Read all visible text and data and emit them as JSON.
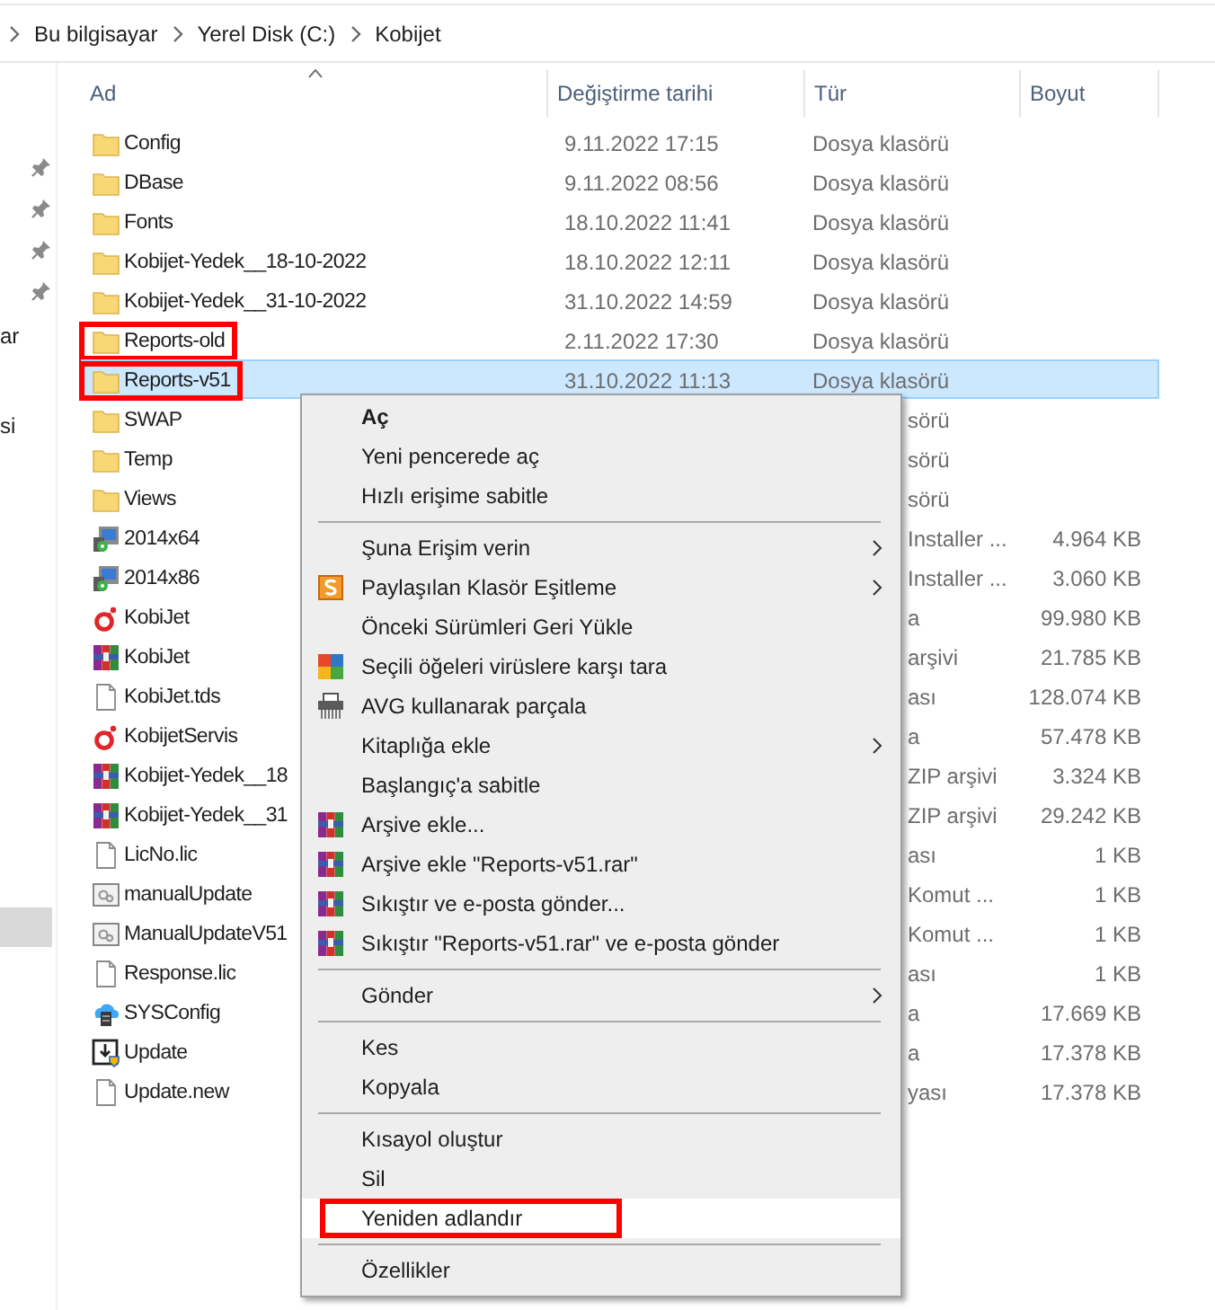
{
  "breadcrumb": [
    "Bu bilgisayar",
    "Yerel Disk (C:)",
    "Kobijet"
  ],
  "nav": {
    "items": [
      {
        "kind": "pin",
        "selected": false
      },
      {
        "kind": "pin",
        "selected": false
      },
      {
        "kind": "pin",
        "selected": false
      },
      {
        "kind": "pin",
        "selected": false
      },
      {
        "kind": "label",
        "text": "ar",
        "selected": false
      },
      {
        "kind": "label",
        "text": "si",
        "selected": false
      },
      {
        "kind": "row",
        "selected": true
      }
    ]
  },
  "table": {
    "columns": [
      {
        "label": "Ad",
        "sorted": true
      },
      {
        "label": "Değiştirme tarihi",
        "sorted": false
      },
      {
        "label": "Tür",
        "sorted": false
      },
      {
        "label": "Boyut",
        "sorted": false
      }
    ],
    "rows": [
      {
        "kind": "folder",
        "name": "Config",
        "date": "9.11.2022 17:15",
        "type": "Dosya klasörü",
        "selected": false,
        "highlighted": false
      },
      {
        "kind": "folder",
        "name": "DBase",
        "date": "9.11.2022 08:56",
        "type": "Dosya klasörü",
        "selected": false,
        "highlighted": false
      },
      {
        "kind": "folder",
        "name": "Fonts",
        "date": "18.10.2022 11:41",
        "type": "Dosya klasörü",
        "selected": false,
        "highlighted": false
      },
      {
        "kind": "folder",
        "name": "Kobijet-Yedek__18-10-2022",
        "date": "18.10.2022 12:11",
        "type": "Dosya klasörü",
        "selected": false,
        "highlighted": false
      },
      {
        "kind": "folder",
        "name": "Kobijet-Yedek__31-10-2022",
        "date": "31.10.2022 14:59",
        "type": "Dosya klasörü",
        "selected": false,
        "highlighted": false
      },
      {
        "kind": "folder",
        "name": "Reports-old",
        "date": "2.11.2022 17:30",
        "type": "Dosya klasörü",
        "selected": false,
        "highlighted": true
      },
      {
        "kind": "folder",
        "name": "Reports-v51",
        "date": "31.10.2022 11:13",
        "type": "Dosya klasörü",
        "selected": true,
        "highlighted": true
      },
      {
        "kind": "folder",
        "name": "SWAP",
        "type": "sörü",
        "selected": false,
        "highlighted": false
      },
      {
        "kind": "folder",
        "name": "Temp",
        "type": "sörü",
        "selected": false,
        "highlighted": false
      },
      {
        "kind": "folder",
        "name": "Views",
        "type": "sörü",
        "selected": false,
        "highlighted": false
      },
      {
        "kind": "installer",
        "name": "2014x64",
        "type": "Installer ...",
        "size": "4.964 KB",
        "selected": false,
        "highlighted": false
      },
      {
        "kind": "installer",
        "name": "2014x86",
        "type": "Installer ...",
        "size": "3.060 KB",
        "selected": false,
        "highlighted": false
      },
      {
        "kind": "application",
        "name": "KobiJet",
        "type": "a",
        "size": "99.980 KB",
        "selected": false,
        "highlighted": false
      },
      {
        "kind": "archive",
        "name": "KobiJet",
        "type": "arşivi",
        "size": "21.785 KB",
        "selected": false,
        "highlighted": false
      },
      {
        "kind": "document",
        "name": "KobiJet.tds",
        "type": "ası",
        "size": "128.074 KB",
        "selected": false,
        "highlighted": false
      },
      {
        "kind": "application",
        "name": "KobijetServis",
        "type": "a",
        "size": "57.478 KB",
        "selected": false,
        "highlighted": false
      },
      {
        "kind": "archive",
        "name": "Kobijet-Yedek__18",
        "type": "ZIP arşivi",
        "size": "3.324 KB",
        "selected": false,
        "highlighted": false
      },
      {
        "kind": "archive",
        "name": "Kobijet-Yedek__31",
        "type": "ZIP arşivi",
        "size": "29.242 KB",
        "selected": false,
        "highlighted": false
      },
      {
        "kind": "document",
        "name": "LicNo.lic",
        "type": "ası",
        "size": "1 KB",
        "selected": false,
        "highlighted": false
      },
      {
        "kind": "script",
        "name": "manualUpdate",
        "type": "Komut ...",
        "size": "1 KB",
        "selected": false,
        "highlighted": false
      },
      {
        "kind": "script",
        "name": "ManualUpdateV51",
        "type": "Komut ...",
        "size": "1 KB",
        "selected": false,
        "highlighted": false
      },
      {
        "kind": "document",
        "name": "Response.lic",
        "type": "ası",
        "size": "1 KB",
        "selected": false,
        "highlighted": false
      },
      {
        "kind": "service",
        "name": "SYSConfig",
        "type": "a",
        "size": "17.669 KB",
        "selected": false,
        "highlighted": false
      },
      {
        "kind": "updater",
        "name": "Update",
        "type": "a",
        "size": "17.378 KB",
        "selected": false,
        "highlighted": false
      },
      {
        "kind": "document",
        "name": "Update.new",
        "type": "yası",
        "size": "17.378 KB",
        "selected": false,
        "highlighted": false
      }
    ]
  },
  "context_menu": {
    "items": [
      {
        "kind": "plain",
        "label": "Aç",
        "bold": true,
        "submenu": false,
        "selected": false,
        "highlighted": false
      },
      {
        "kind": "plain",
        "label": "Yeni pencerede aç",
        "bold": false,
        "submenu": false,
        "selected": false,
        "highlighted": false
      },
      {
        "kind": "plain",
        "label": "Hızlı erişime sabitle",
        "bold": false,
        "submenu": false,
        "selected": false,
        "highlighted": false
      },
      {
        "kind": "separator"
      },
      {
        "kind": "plain",
        "label": "Şuna Erişim verin",
        "bold": false,
        "submenu": true,
        "selected": false,
        "highlighted": false
      },
      {
        "kind": "sync",
        "label": "Paylaşılan Klasör Eşitleme",
        "bold": false,
        "submenu": true,
        "selected": false,
        "highlighted": false
      },
      {
        "kind": "plain",
        "label": "Önceki Sürümleri Geri Yükle",
        "bold": false,
        "submenu": false,
        "selected": false,
        "highlighted": false
      },
      {
        "kind": "antivirus",
        "label": "Seçili öğeleri virüslere karşı tara",
        "bold": false,
        "submenu": false,
        "selected": false,
        "highlighted": false
      },
      {
        "kind": "shredder",
        "label": "AVG kullanarak parçala",
        "bold": false,
        "submenu": false,
        "selected": false,
        "highlighted": false
      },
      {
        "kind": "plain",
        "label": "Kitaplığa ekle",
        "bold": false,
        "submenu": true,
        "selected": false,
        "highlighted": false
      },
      {
        "kind": "plain",
        "label": "Başlangıç'a sabitle",
        "bold": false,
        "submenu": false,
        "selected": false,
        "highlighted": false
      },
      {
        "kind": "archive",
        "label": "Arşive ekle...",
        "bold": false,
        "submenu": false,
        "selected": false,
        "highlighted": false
      },
      {
        "kind": "archive",
        "label": "Arşive ekle \"Reports-v51.rar\"",
        "bold": false,
        "submenu": false,
        "selected": false,
        "highlighted": false
      },
      {
        "kind": "archive",
        "label": "Sıkıştır ve e-posta gönder...",
        "bold": false,
        "submenu": false,
        "selected": false,
        "highlighted": false
      },
      {
        "kind": "archive",
        "label": "Sıkıştır \"Reports-v51.rar\" ve e-posta gönder",
        "bold": false,
        "submenu": false,
        "selected": false,
        "highlighted": false
      },
      {
        "kind": "separator"
      },
      {
        "kind": "plain",
        "label": "Gönder",
        "bold": false,
        "submenu": true,
        "selected": false,
        "highlighted": false
      },
      {
        "kind": "separator"
      },
      {
        "kind": "plain",
        "label": "Kes",
        "bold": false,
        "submenu": false,
        "selected": false,
        "highlighted": false
      },
      {
        "kind": "plain",
        "label": "Kopyala",
        "bold": false,
        "submenu": false,
        "selected": false,
        "highlighted": false
      },
      {
        "kind": "separator"
      },
      {
        "kind": "plain",
        "label": "Kısayol oluştur",
        "bold": false,
        "submenu": false,
        "selected": false,
        "highlighted": false
      },
      {
        "kind": "plain",
        "label": "Sil",
        "bold": false,
        "submenu": false,
        "selected": false,
        "highlighted": false
      },
      {
        "kind": "plain",
        "label": "Yeniden adlandır",
        "bold": false,
        "submenu": false,
        "selected": true,
        "highlighted": true
      },
      {
        "kind": "separator"
      },
      {
        "kind": "plain",
        "label": "Özellikler",
        "bold": false,
        "submenu": false,
        "selected": false,
        "highlighted": false
      }
    ]
  }
}
